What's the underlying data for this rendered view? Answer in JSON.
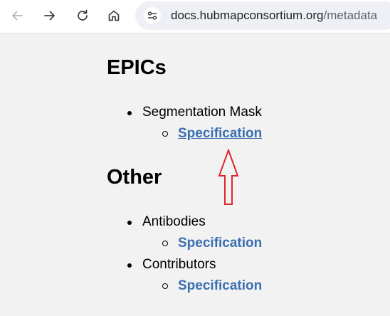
{
  "browser": {
    "url_host": "docs.hubmapconsortium.org",
    "url_path": "/metadata",
    "icons": [
      "back-arrow-icon",
      "forward-arrow-icon",
      "reload-icon",
      "home-icon",
      "site-settings-icon"
    ]
  },
  "page": {
    "sections": [
      {
        "heading": "EPICs",
        "items": [
          {
            "label": "Segmentation Mask",
            "link": "Specification"
          }
        ]
      },
      {
        "heading": "Other",
        "items": [
          {
            "label": "Antibodies",
            "link": "Specification"
          },
          {
            "label": "Contributors",
            "link": "Specification"
          }
        ]
      }
    ],
    "annotation": {
      "type": "arrow-up",
      "color": "#e0252f"
    }
  }
}
